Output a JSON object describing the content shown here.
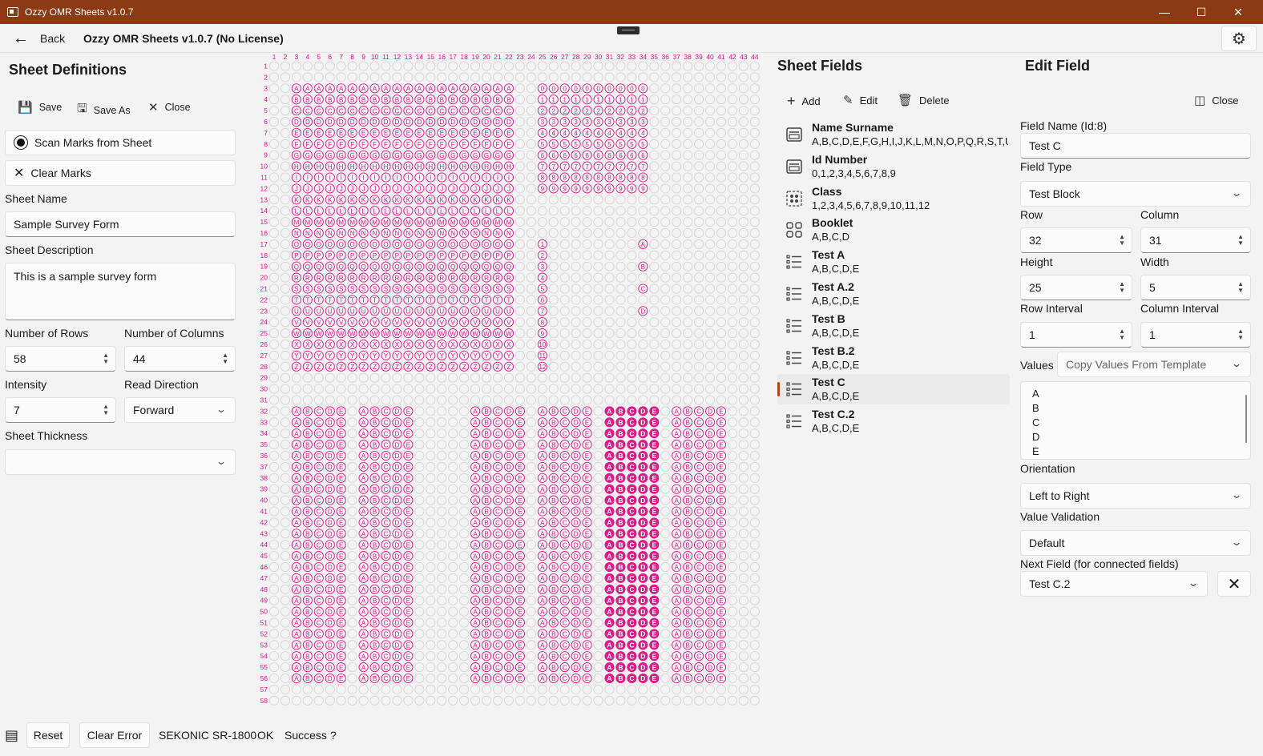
{
  "window": {
    "title": "Ozzy OMR Sheets v1.0.7"
  },
  "header": {
    "back_label": "Back",
    "app_title": "Ozzy OMR Sheets v1.0.7 (No License)"
  },
  "left": {
    "title": "Sheet Definitions",
    "save": "Save",
    "save_as": "Save As",
    "close": "Close",
    "scan_marks": "Scan Marks from Sheet",
    "clear_marks": "Clear Marks",
    "sheet_name_label": "Sheet Name",
    "sheet_name": "Sample Survey Form",
    "sheet_desc_label": "Sheet Description",
    "sheet_desc": "This is a sample survey form",
    "rows_label": "Number of Rows",
    "rows": "58",
    "cols_label": "Number of Columns",
    "cols": "44",
    "intensity_label": "Intensity",
    "intensity": "7",
    "read_dir_label": "Read Direction",
    "read_dir": "Forward",
    "thickness_label": "Sheet Thickness",
    "thickness": ""
  },
  "grid": {
    "rows": 58,
    "cols": 44,
    "accent": "#e0188a"
  },
  "sheet_fields": {
    "title": "Sheet Fields",
    "add": "Add",
    "edit": "Edit",
    "delete": "Delete",
    "items": [
      {
        "name": "Name Surname",
        "values": "A,B,C,D,E,F,G,H,I,J,K,L,M,N,O,P,Q,R,S,T,U,",
        "icon": "form-icon"
      },
      {
        "name": "Id Number",
        "values": "0,1,2,3,4,5,6,7,8,9",
        "icon": "form-icon"
      },
      {
        "name": "Class",
        "values": "1,2,3,4,5,6,7,8,9,10,11,12",
        "icon": "dotted-grid-icon"
      },
      {
        "name": "Booklet",
        "values": "A,B,C,D",
        "icon": "grid-icon"
      },
      {
        "name": "Test A",
        "values": "A,B,C,D,E",
        "icon": "list-icon"
      },
      {
        "name": "Test A.2",
        "values": "A,B,C,D,E",
        "icon": "list-icon"
      },
      {
        "name": "Test B",
        "values": "A,B,C,D,E",
        "icon": "list-icon"
      },
      {
        "name": "Test B.2",
        "values": "A,B,C,D,E",
        "icon": "list-icon"
      },
      {
        "name": "Test C",
        "values": "A,B,C,D,E",
        "icon": "list-icon"
      },
      {
        "name": "Test C.2",
        "values": "A,B,C,D,E",
        "icon": "list-icon"
      }
    ],
    "selected_index": 8
  },
  "edit_field": {
    "title": "Edit Field",
    "close": "Close",
    "name_label": "Field Name (Id:8)",
    "name": "Test C",
    "type_label": "Field Type",
    "type": "Test Block",
    "row_label": "Row",
    "row": "32",
    "column_label": "Column",
    "column": "31",
    "height_label": "Height",
    "height": "25",
    "width_label": "Width",
    "width": "5",
    "row_interval_label": "Row Interval",
    "row_interval": "1",
    "col_interval_label": "Column Interval",
    "col_interval": "1",
    "values_label": "Values",
    "copy_template": "Copy Values From Template",
    "values": [
      "A",
      "B",
      "C",
      "D",
      "E"
    ],
    "orientation_label": "Orientation",
    "orientation": "Left to Right",
    "validation_label": "Value Validation",
    "validation": "Default",
    "next_field_label": "Next Field (for connected fields)",
    "next_field": "Test C.2"
  },
  "status": {
    "reset": "Reset",
    "clear_error": "Clear Error",
    "device": "SEKONIC SR-1800",
    "ok": "OK",
    "result": "Success",
    "help": "?"
  }
}
